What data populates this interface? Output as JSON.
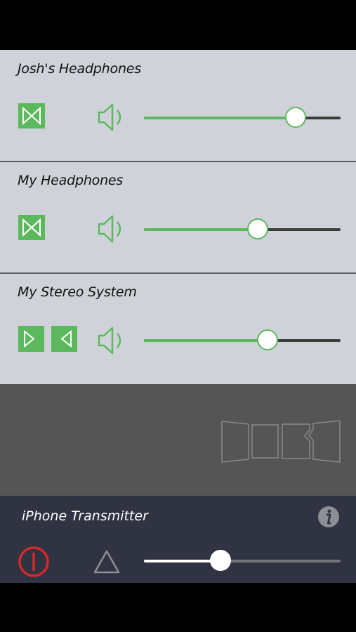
{
  "devices": [
    {
      "name": "Josh's Headphones",
      "type": "headphones",
      "volume": 0.77
    },
    {
      "name": "My Headphones",
      "type": "headphones",
      "volume": 0.58
    },
    {
      "name": "My Stereo System",
      "type": "stereo",
      "volume": 0.63
    }
  ],
  "transmitter": {
    "name": "iPhone Transmitter",
    "volume": 0.39
  },
  "colors": {
    "accent": "#5cb85c",
    "panel": "#d0d2da",
    "power": "#d42a2a",
    "transmitter_bg": "#2f3342"
  },
  "icons": {
    "headphones": "bowtie-icon",
    "stereo_left": "play-left-icon",
    "stereo_right": "play-right-icon",
    "volume": "speaker-icon",
    "power": "power-icon",
    "warning": "triangle-icon",
    "info": "info-icon",
    "logo": "panels-logo"
  }
}
